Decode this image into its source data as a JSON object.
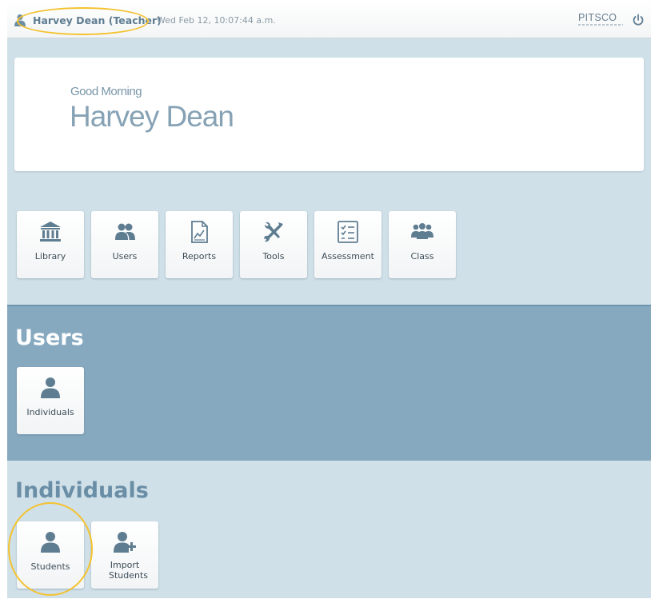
{
  "header": {
    "user_name": "Harvey Dean (Teacher)",
    "datetime": "Wed Feb 12,  10:07:44 a.m.",
    "brand": "PITSCO"
  },
  "greeting": {
    "salutation": "Good Morning",
    "name": "Harvey Dean"
  },
  "main_tiles": [
    {
      "label": "Library",
      "icon": "library-icon"
    },
    {
      "label": "Users",
      "icon": "users-icon"
    },
    {
      "label": "Reports",
      "icon": "reports-icon"
    },
    {
      "label": "Tools",
      "icon": "tools-icon"
    },
    {
      "label": "Assessment",
      "icon": "assessment-icon"
    },
    {
      "label": "Class",
      "icon": "class-icon"
    }
  ],
  "users_section": {
    "title": "Users",
    "tiles": [
      {
        "label": "Individuals",
        "icon": "person-icon"
      }
    ]
  },
  "individuals_section": {
    "title": "Individuals",
    "tiles": [
      {
        "label": "Students",
        "icon": "person-icon"
      },
      {
        "label": "Import Students",
        "icon": "add-person-icon"
      }
    ]
  },
  "colors": {
    "accent": "#5f7d91",
    "highlight": "#f4c22f",
    "section_dark": "#86a9c0",
    "section_light": "#d0e0e9"
  }
}
